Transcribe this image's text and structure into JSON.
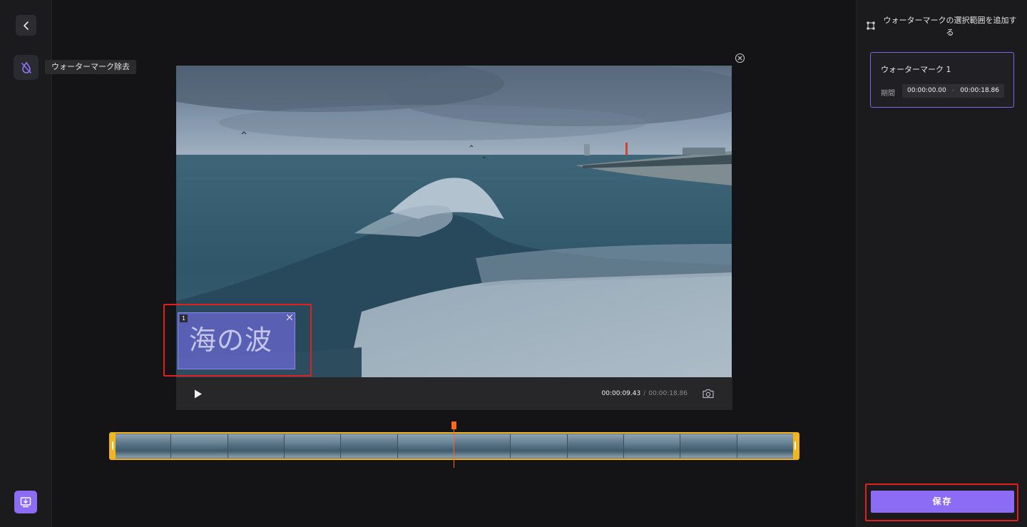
{
  "left_rail": {
    "back_icon": "chevron-left-icon",
    "tool_icon": "watermark-remove-icon",
    "tool_tooltip": "ウォーターマーク除去",
    "export_icon": "export-monitor-icon"
  },
  "player": {
    "current_time": "00:00:09.43",
    "separator": "/",
    "total_time": "00:00:18.86",
    "play_icon": "play-icon",
    "snapshot_icon": "camera-icon",
    "close_icon": "close-circle-icon"
  },
  "watermark_overlay": {
    "index": "1",
    "text": "海の波"
  },
  "timeline": {
    "frame_count": 12,
    "playhead_fraction": 0.5
  },
  "right_panel": {
    "add_region_label": "ウォーターマークの選択範囲を追加する",
    "card": {
      "title": "ウォーターマーク 1",
      "duration_label": "期間",
      "start": "00:00:00.00",
      "dash": "-",
      "end": "00:00:18.86"
    },
    "save_label": "保存"
  },
  "colors": {
    "accent": "#8c6cf5",
    "highlight": "#e0201f",
    "timeline_border": "#f1b520",
    "playhead": "#ff6a1a"
  }
}
